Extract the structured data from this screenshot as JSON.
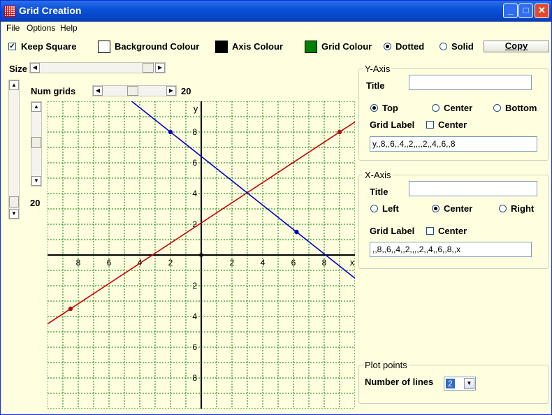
{
  "window": {
    "title": "Grid Creation"
  },
  "menu": {
    "file": "File",
    "options": "Options",
    "help": "Help"
  },
  "toolbar": {
    "keep_square": "Keep Square",
    "background_colour": "Background Colour",
    "axis_colour": "Axis Colour",
    "grid_colour": "Grid Colour",
    "dotted": "Dotted",
    "solid": "Solid",
    "copy": "Copy",
    "background_swatch": "#ffffff",
    "axis_swatch": "#000000",
    "grid_swatch": "#008000"
  },
  "size": {
    "label": "Size"
  },
  "num_grids": {
    "label": "Num grids",
    "value": "20"
  },
  "side_value": "20",
  "y_axis": {
    "group": "Y-Axis",
    "title_label": "Title",
    "title_value": "",
    "top": "Top",
    "center": "Center",
    "bottom": "Bottom",
    "grid_label": "Grid Label",
    "grid_center": "Center",
    "labels_value": "y,,8,,6,,4,,2,,,,2,,4,,6,,8"
  },
  "x_axis": {
    "group": "X-Axis",
    "title_label": "Title",
    "title_value": "",
    "left": "Left",
    "center": "Center",
    "right": "Right",
    "grid_label": "Grid Label",
    "grid_center": "Center",
    "labels_value": ",,8,,6,,4,,2,,,,2,,4,,6,,8,,x"
  },
  "plot_points": {
    "group": "Plot points",
    "number_label": "Number of lines",
    "number_value": "2"
  },
  "chart_data": {
    "type": "line",
    "xlim": [
      -10,
      10
    ],
    "ylim": [
      -10,
      10
    ],
    "grid_step": 1,
    "x_tick_labels": [
      {
        "v": -8,
        "t": "8"
      },
      {
        "v": -6,
        "t": "6"
      },
      {
        "v": -4,
        "t": "4"
      },
      {
        "v": -2,
        "t": "2"
      },
      {
        "v": 2,
        "t": "2"
      },
      {
        "v": 4,
        "t": "4"
      },
      {
        "v": 6,
        "t": "6"
      },
      {
        "v": 8,
        "t": "8"
      }
    ],
    "y_tick_labels": [
      {
        "v": 8,
        "t": "8"
      },
      {
        "v": 6,
        "t": "6"
      },
      {
        "v": 4,
        "t": "4"
      },
      {
        "v": 2,
        "t": "2"
      },
      {
        "v": -2,
        "t": "2"
      },
      {
        "v": -4,
        "t": "4"
      },
      {
        "v": -6,
        "t": "6"
      },
      {
        "v": -8,
        "t": "8"
      }
    ],
    "x_axis_label": "x",
    "y_axis_label": "y",
    "grid_color": "#008000",
    "axis_color": "#000000",
    "series": [
      {
        "color": "#cc0000",
        "points": [
          [
            -8.5,
            -3.5
          ],
          [
            9.0,
            8.0
          ]
        ]
      },
      {
        "color": "#0000cc",
        "points": [
          [
            -2.0,
            8.0
          ],
          [
            6.2,
            1.5
          ]
        ]
      }
    ]
  }
}
